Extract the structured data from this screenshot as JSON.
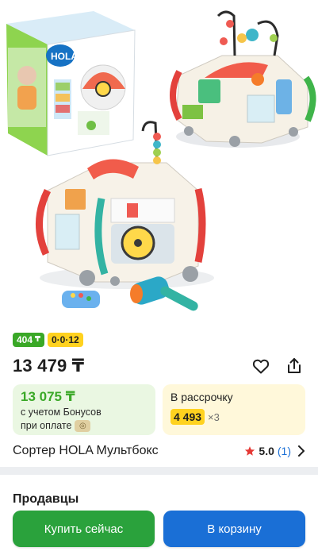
{
  "badges": {
    "bonus_value": "404",
    "bonus_currency": "₸",
    "installment": "0·0·12"
  },
  "price": {
    "current": "13 479 ₸"
  },
  "bonus_card": {
    "price": "13 075 ₸",
    "line1": "с учетом Бонусов",
    "line2": "при оплате"
  },
  "installment_card": {
    "title": "В рассрочку",
    "amount": "4 493",
    "multiplier": "×3"
  },
  "product": {
    "title": "Сортер HOLA Мультбокс",
    "rating": "5.0",
    "reviews": "(1)"
  },
  "sellers": {
    "title": "Продавцы"
  },
  "actions": {
    "buy_now": "Купить сейчас",
    "add_to_cart": "В корзину"
  },
  "box_brand": "HOLA",
  "colors": {
    "green": "#3aa827",
    "yellow": "#ffd21f",
    "blue": "#1a6fd6",
    "buy_green": "#2aa23c",
    "star": "#e53935"
  },
  "icons": [
    "heart-outline-icon",
    "share-icon",
    "star-icon",
    "chevron-right-icon",
    "coin-icon"
  ]
}
